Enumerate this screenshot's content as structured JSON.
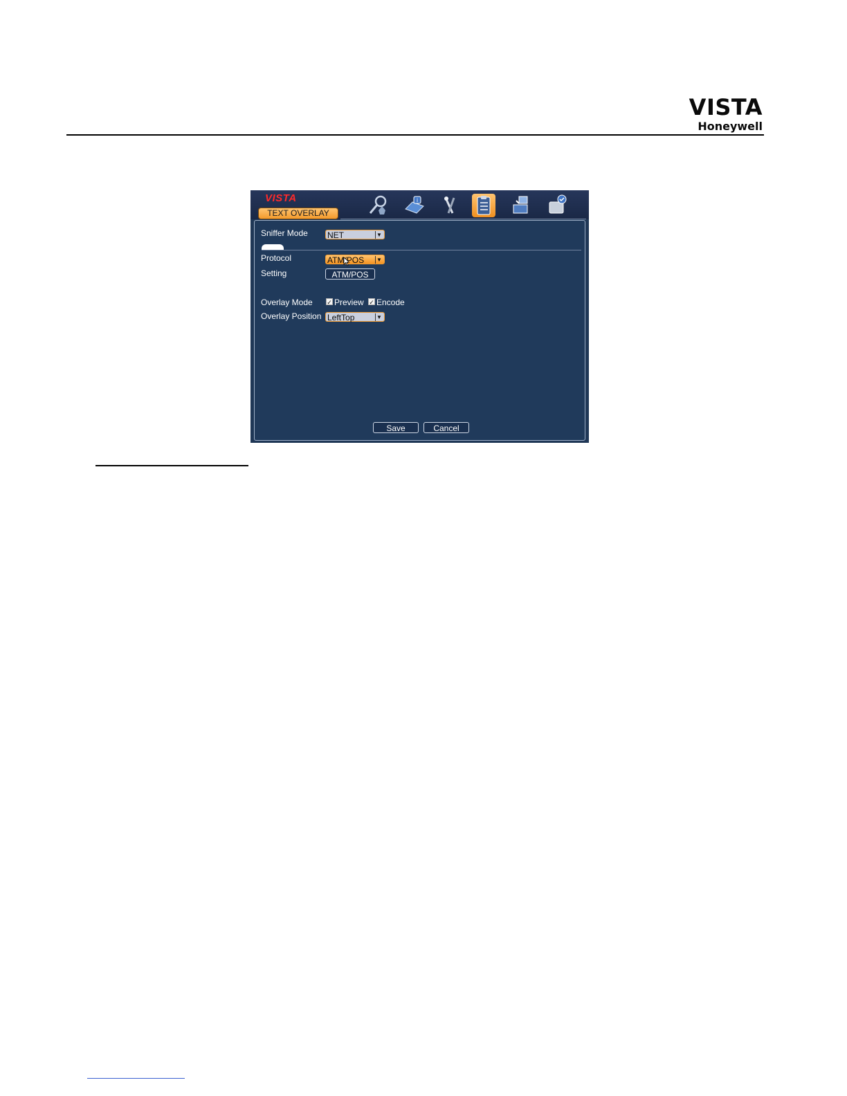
{
  "brand": {
    "line1": "VISTA",
    "line2": "Honeywell"
  },
  "dvr": {
    "logo": "VISTA",
    "tab_title": "TEXT OVERLAY",
    "toolbar_icons": [
      "search-person-icon",
      "info-book-icon",
      "tools-icon",
      "clipboard-settings-icon",
      "network-icon",
      "disk-icon"
    ],
    "active_icon": "clipboard-settings-icon",
    "sniffer_mode": {
      "label": "Sniffer Mode",
      "value": "NET"
    },
    "protocol": {
      "label": "Protocol",
      "value": "ATM/POS"
    },
    "setting": {
      "label": "Setting",
      "button": "ATM/POS"
    },
    "overlay_mode": {
      "label": "Overlay Mode",
      "preview": "Preview",
      "preview_checked": true,
      "encode": "Encode",
      "encode_checked": true
    },
    "overlay_position": {
      "label": "Overlay Position",
      "value": "LeftTop"
    },
    "save": "Save",
    "cancel": "Cancel",
    "colors": {
      "bg": "#203a5b",
      "accent": "#f59422",
      "logo": "#ff2a2a"
    }
  }
}
